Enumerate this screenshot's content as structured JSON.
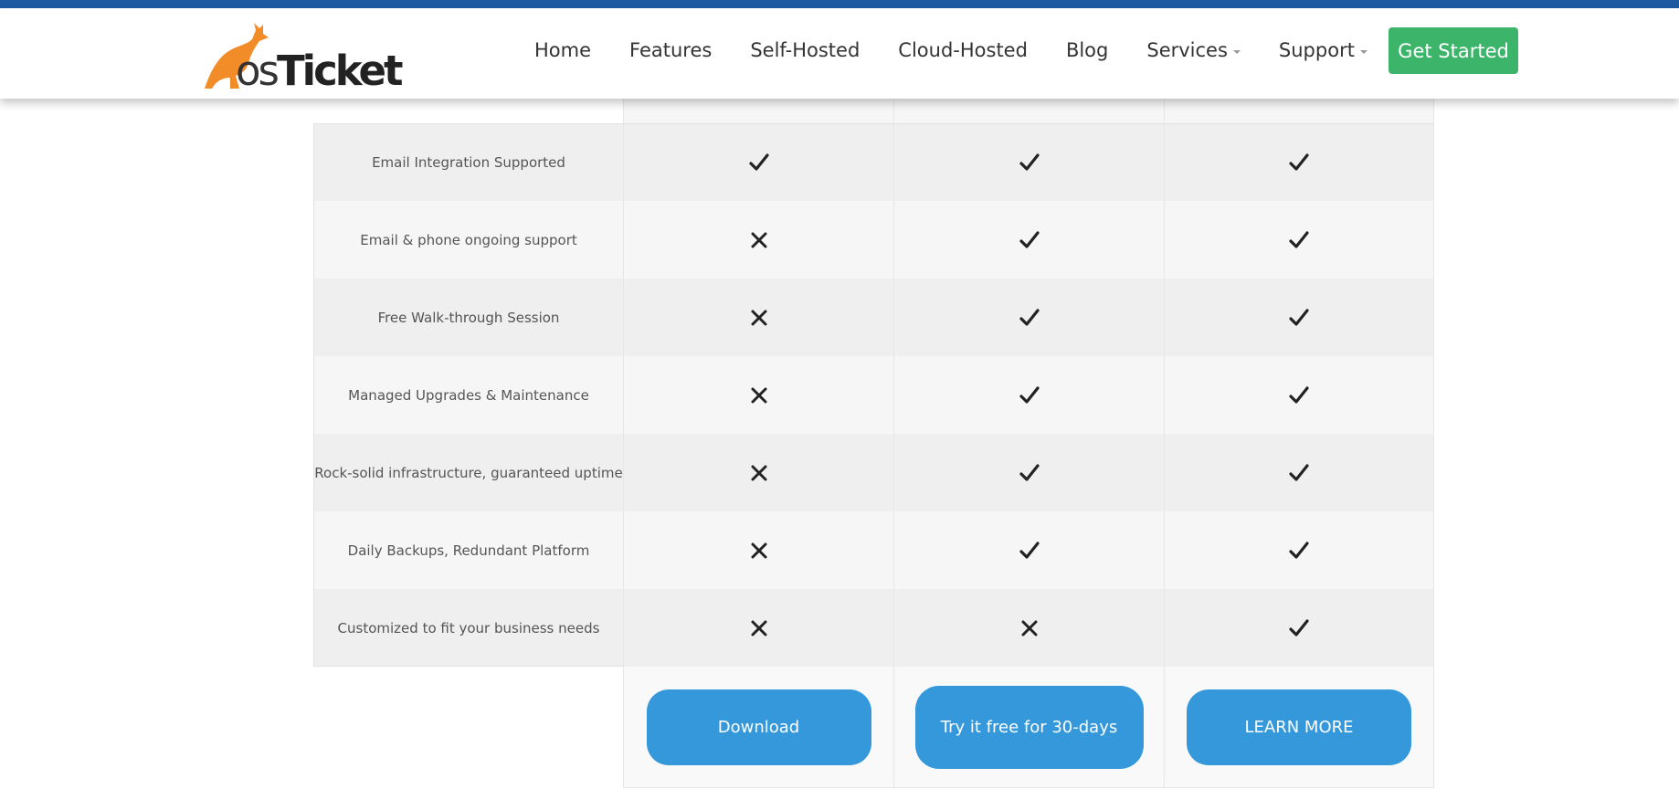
{
  "brand": {
    "logo_text_os": "os",
    "logo_text_ticket": "Ticket",
    "accent_orange": "#f28c28",
    "nav_blue": "#1d5aa1",
    "button_blue": "#3498db",
    "cta_green": "#3cb56b"
  },
  "nav": {
    "items": [
      {
        "label": "Home"
      },
      {
        "label": "Features"
      },
      {
        "label": "Self-Hosted"
      },
      {
        "label": "Cloud-Hosted"
      },
      {
        "label": "Blog"
      },
      {
        "label": "Services",
        "dropdown": true
      },
      {
        "label": "Support",
        "dropdown": true
      }
    ],
    "get_started": "Get Started"
  },
  "comparison": {
    "rows": [
      {
        "feature": "Email Integration Supported",
        "values": [
          "check",
          "check",
          "check"
        ]
      },
      {
        "feature": "Email & phone ongoing support",
        "values": [
          "cross",
          "check",
          "check"
        ]
      },
      {
        "feature": "Free Walk-through Session",
        "values": [
          "cross",
          "check",
          "check"
        ]
      },
      {
        "feature": "Managed Upgrades & Maintenance",
        "values": [
          "cross",
          "check",
          "check"
        ]
      },
      {
        "feature": "Rock-solid infrastructure, guaranteed uptime",
        "values": [
          "cross",
          "check",
          "check"
        ]
      },
      {
        "feature": "Daily Backups, Redundant Platform",
        "values": [
          "cross",
          "check",
          "check"
        ]
      },
      {
        "feature": "Customized to fit your business needs",
        "values": [
          "cross",
          "cross",
          "check"
        ]
      }
    ],
    "buttons": [
      {
        "label": "Download"
      },
      {
        "label": "Try it free for 30-days"
      },
      {
        "label": "LEARN MORE"
      }
    ]
  }
}
